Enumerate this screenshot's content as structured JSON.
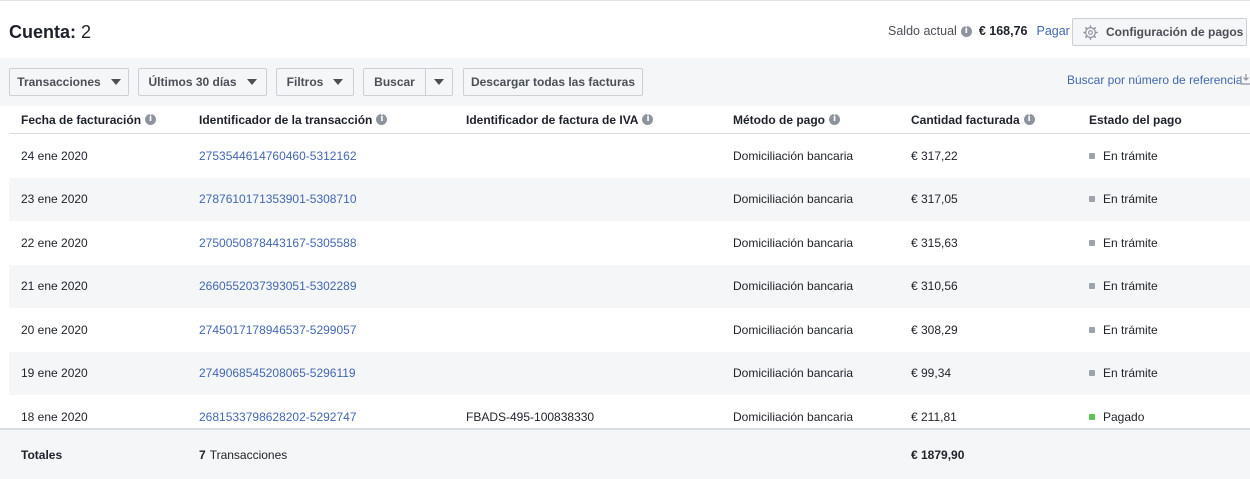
{
  "header": {
    "account_label": "Cuenta:",
    "account_number": "2",
    "balance_label": "Saldo actual",
    "balance_amount": "€ 168,76",
    "pay_link": "Pagar",
    "config_button": "Configuración de pagos"
  },
  "toolbar": {
    "transactions": "Transacciones",
    "period": "Últimos 30 días",
    "filters": "Filtros",
    "search": "Buscar",
    "download": "Descargar todas las facturas",
    "reference_search": "Buscar por número de referencia"
  },
  "table": {
    "columns": [
      "Fecha de facturación",
      "Identificador de la transacción",
      "Identificador de factura de IVA",
      "Método de pago",
      "Cantidad facturada",
      "Estado del pago"
    ],
    "rows": [
      {
        "date": "24 ene 2020",
        "transaction_id": "2753544614760460-5312162",
        "vat_id": "",
        "method": "Domiciliación bancaria",
        "amount": "€ 317,22",
        "status": "En trámite"
      },
      {
        "date": "23 ene 2020",
        "transaction_id": "2787610171353901-5308710",
        "vat_id": "",
        "method": "Domiciliación bancaria",
        "amount": "€ 317,05",
        "status": "En trámite"
      },
      {
        "date": "22 ene 2020",
        "transaction_id": "2750050878443167-5305588",
        "vat_id": "",
        "method": "Domiciliación bancaria",
        "amount": "€ 315,63",
        "status": "En trámite"
      },
      {
        "date": "21 ene 2020",
        "transaction_id": "2660552037393051-5302289",
        "vat_id": "",
        "method": "Domiciliación bancaria",
        "amount": "€ 310,56",
        "status": "En trámite"
      },
      {
        "date": "20 ene 2020",
        "transaction_id": "2745017178946537-5299057",
        "vat_id": "",
        "method": "Domiciliación bancaria",
        "amount": "€ 308,29",
        "status": "En trámite"
      },
      {
        "date": "19 ene 2020",
        "transaction_id": "2749068545208065-5296119",
        "vat_id": "",
        "method": "Domiciliación bancaria",
        "amount": "€ 99,34",
        "status": "En trámite"
      },
      {
        "date": "18 ene 2020",
        "transaction_id": "2681533798628202-5292747",
        "vat_id": "FBADS-495-100838330",
        "method": "Domiciliación bancaria",
        "amount": "€ 211,81",
        "status": "Pagado"
      }
    ],
    "totals": {
      "label": "Totales",
      "count": "7",
      "count_label": "Transacciones",
      "amount": "€ 1879,90"
    }
  },
  "colors": {
    "link": "#4267b2",
    "status_pending": "#9da3ab",
    "status_paid": "#5ac25a"
  }
}
